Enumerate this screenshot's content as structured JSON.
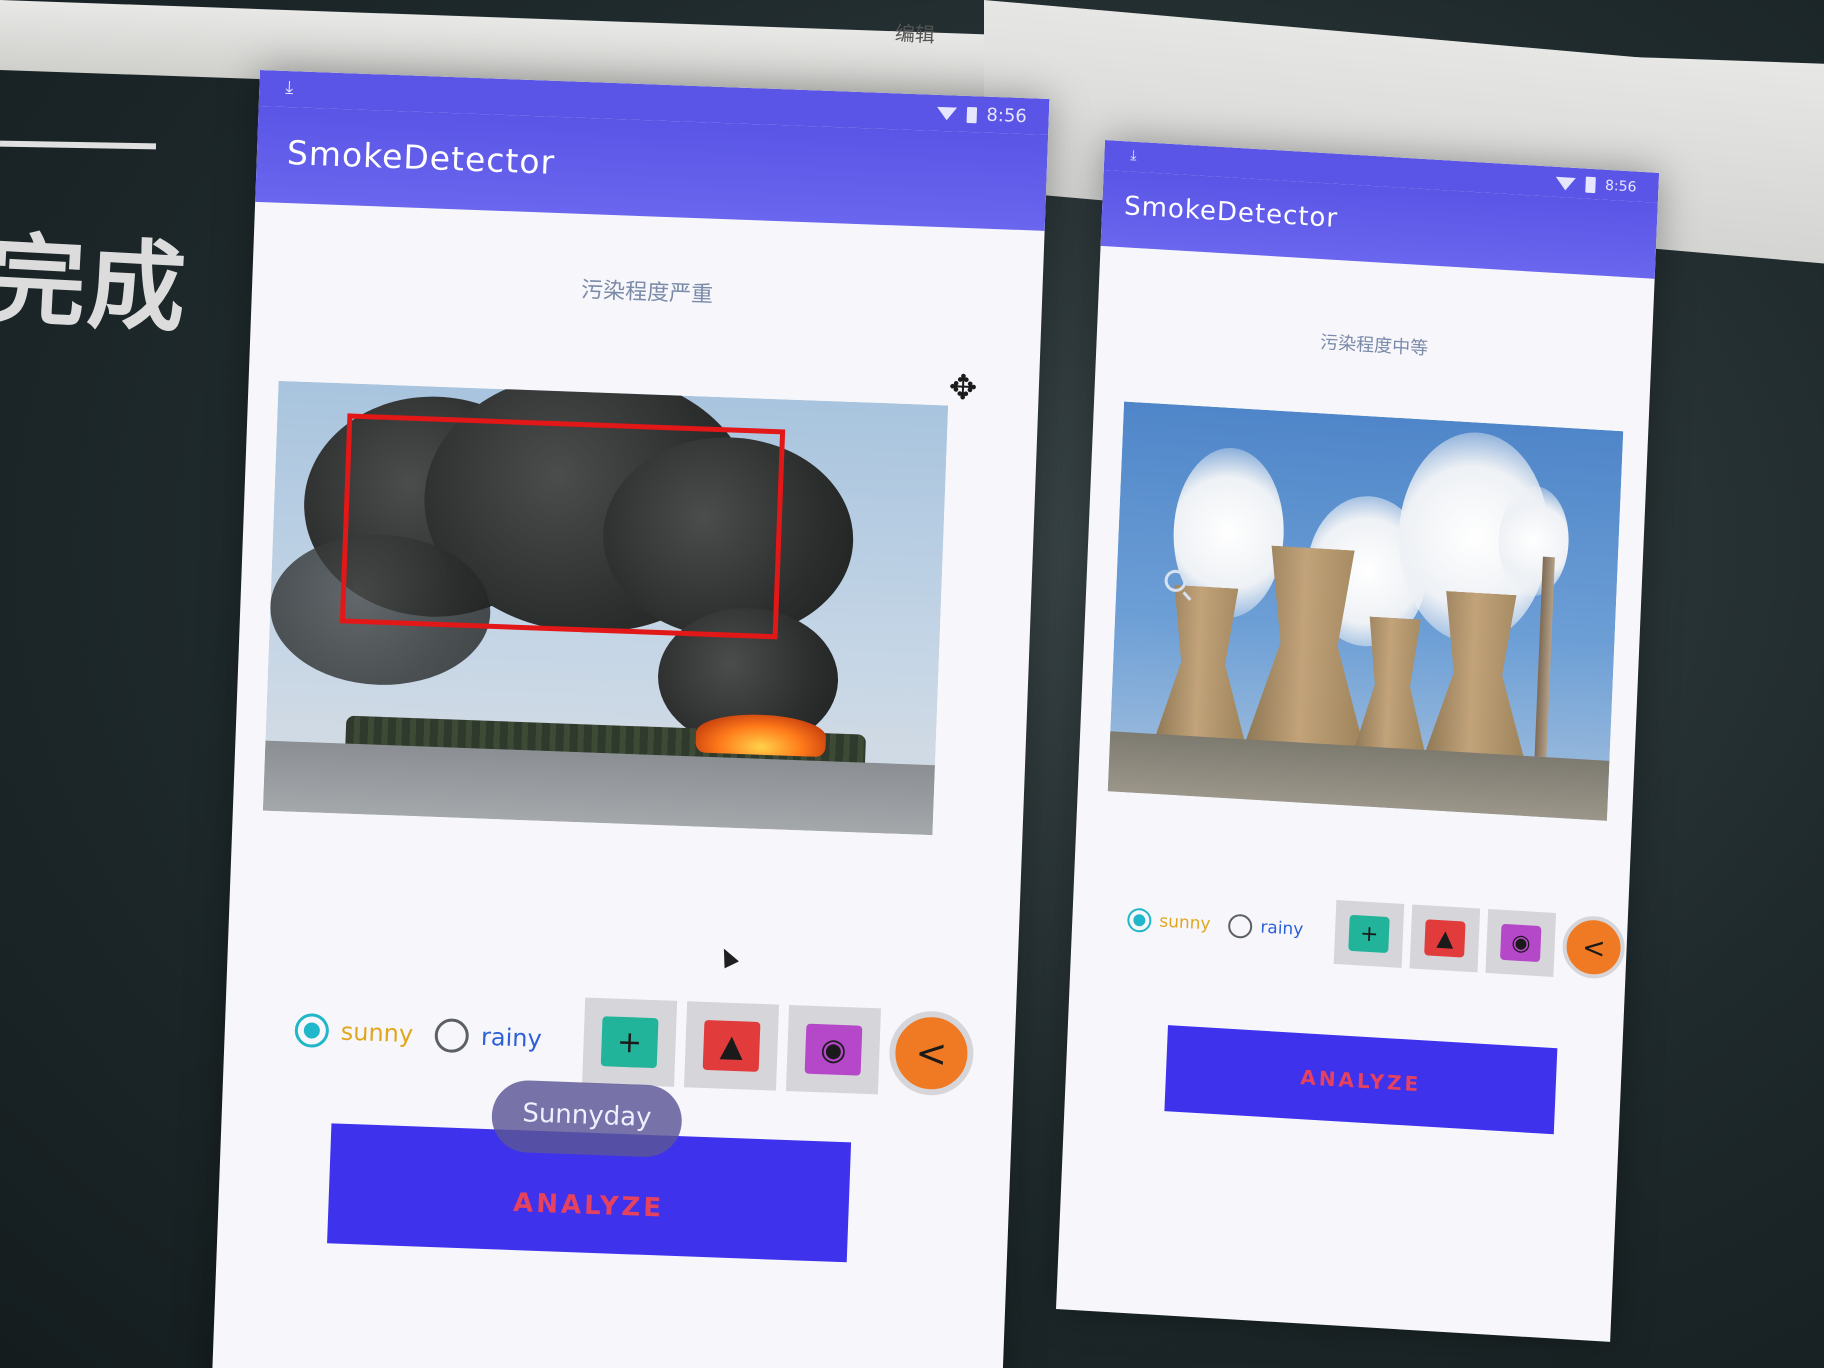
{
  "slide": {
    "ribbon_label": "编辑",
    "heading": "完成"
  },
  "phones": [
    {
      "status_time": "8:56",
      "app_title": "SmokeDetector",
      "pollution_text": "污染程度严重",
      "radio_sunny": "sunny",
      "radio_rainy": "rainy",
      "selected": "sunny",
      "analyze_label": "ANALYZE",
      "toast": "Sunnyday"
    },
    {
      "status_time": "8:56",
      "app_title": "SmokeDetector",
      "pollution_text": "污染程度中等",
      "radio_sunny": "sunny",
      "radio_rainy": "rainy",
      "selected": "sunny",
      "analyze_label": "ANALYZE"
    }
  ],
  "icons": {
    "download": "download-icon",
    "wifi": "wifi-icon",
    "battery": "battery-icon",
    "folder_add": "folder-add-icon",
    "image_add": "add-image-icon",
    "camera": "camera-icon",
    "share": "share-icon"
  },
  "colors": {
    "app_bar": "#5a55e6",
    "analyze_button": "#3f32ec",
    "analyze_text": "#e5425f",
    "radio_checked": "#1fb7c9",
    "sunny_label": "#e0a61e",
    "rainy_label": "#2c5fd8",
    "detection_box": "#e21717"
  }
}
